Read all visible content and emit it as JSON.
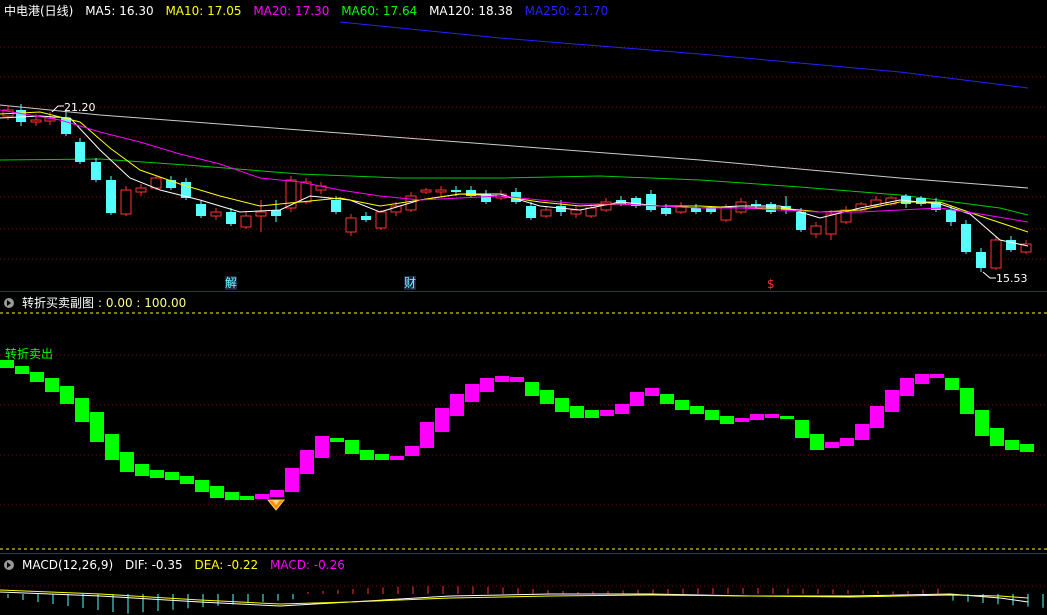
{
  "main": {
    "title": "中电港(日线)",
    "ma": [
      {
        "label": "MA5: 16.30",
        "color": "#ffffff"
      },
      {
        "label": "MA10: 17.05",
        "color": "#ffff00"
      },
      {
        "label": "MA20: 17.30",
        "color": "#ff00ff"
      },
      {
        "label": "MA60: 17.64",
        "color": "#00ff00"
      },
      {
        "label": "MA120: 18.38",
        "color": "#ffffff"
      },
      {
        "label": "MA250: 21.70",
        "color": "#2222ff"
      }
    ],
    "high_label": "21.20",
    "low_label": "15.53",
    "events": [
      {
        "label": "解",
        "color": "#6ff"
      },
      {
        "label": "财",
        "color": "#6ff"
      },
      {
        "label": "$",
        "color": "#ff3030"
      }
    ]
  },
  "sub": {
    "title": "转折买卖副图",
    "values": ": 0.00 : 100.00",
    "signal": "转折卖出"
  },
  "macd": {
    "title": "MACD(12,26,9)",
    "dif": "DIF: -0.35",
    "dea": "DEA: -0.22",
    "macd": "MACD: -0.26"
  },
  "colors": {
    "up": "#ff3232",
    "down": "#54ffff",
    "grid": "#8a0000",
    "buy": "#ff00ff",
    "sell": "#00ff00"
  }
}
